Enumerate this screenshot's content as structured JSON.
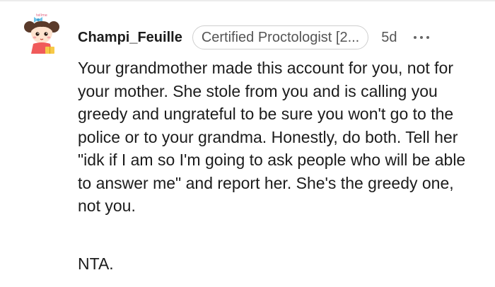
{
  "comment": {
    "username": "Champi_Feuille",
    "flair": "Certified Proctologist [2...",
    "timestamp": "5d",
    "avatar_icon": "cartoon-girl-avatar-icon",
    "more_icon": "more-options-icon",
    "avatar_badge_text": "tellme",
    "body": "Your grandmother made this account for you, not for your mother. She stole from you and is calling you greedy and ungrateful to be sure you won't go to the police or to your grandma. Honestly, do both. Tell her \"idk if I am so I'm going to ask people who will be able to answer me\" and report her. She's the greedy one, not you.",
    "verdict": "NTA."
  },
  "colors": {
    "text": "#1c1c1c",
    "meta": "#555555",
    "flair_border": "#cfcfcf",
    "avatar_hair": "#5a3a2a",
    "avatar_dress": "#f05a5a"
  }
}
